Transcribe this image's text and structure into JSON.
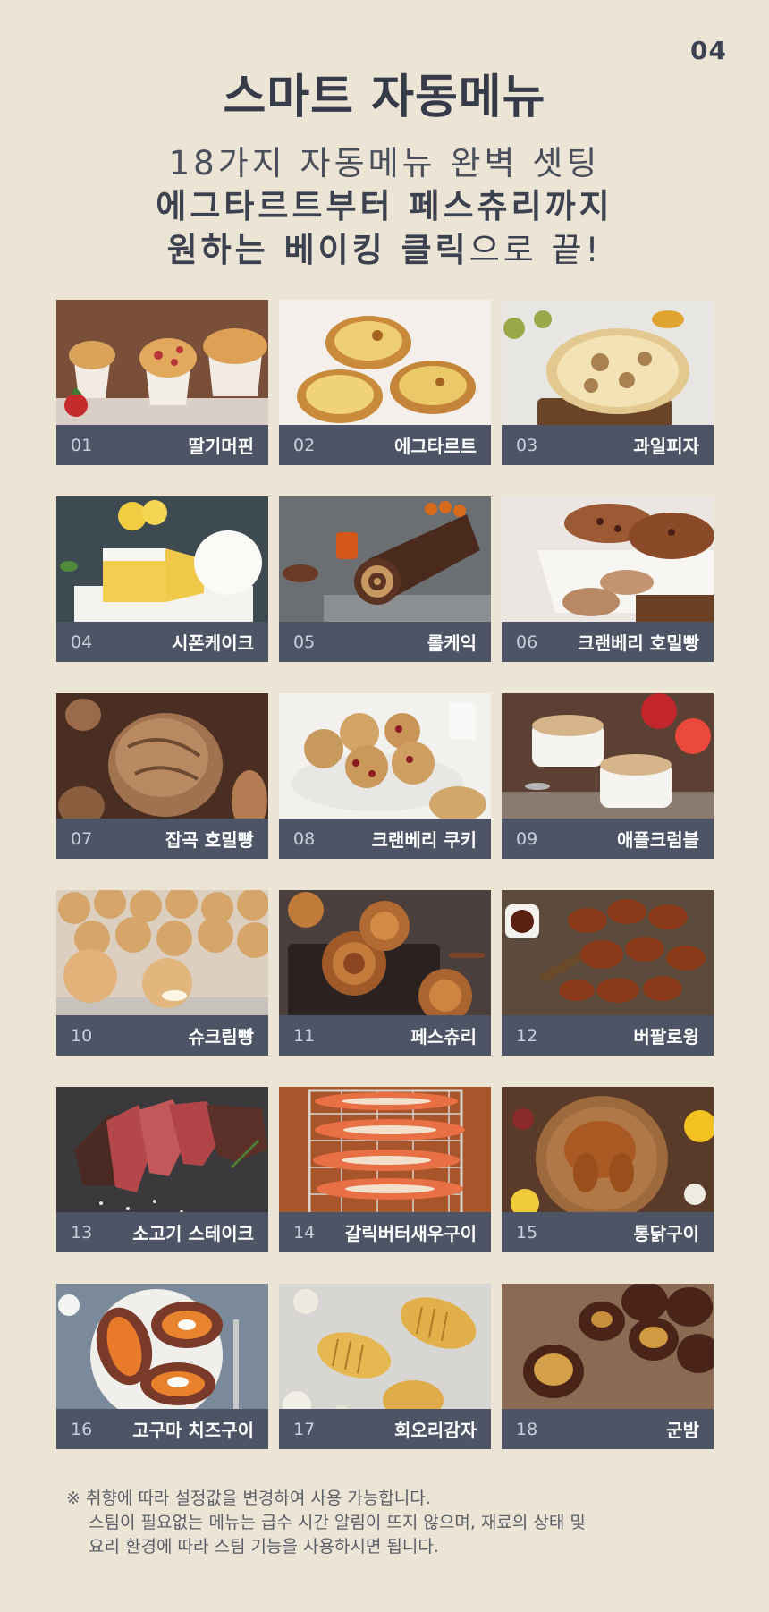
{
  "page_number": "04",
  "title": "스마트 자동메뉴",
  "subtitle_line1": "18가지 자동메뉴 완벽 셋팅",
  "subtitle_line2": "에그타르트부터 페스츄리까지",
  "subtitle_line3_bold": "원하는 베이킹 클릭",
  "subtitle_line3_rest": "으로 끝!",
  "menu_items": [
    {
      "num": "01",
      "name": "딸기머핀"
    },
    {
      "num": "02",
      "name": "에그타르트"
    },
    {
      "num": "03",
      "name": "과일피자"
    },
    {
      "num": "04",
      "name": "시폰케이크"
    },
    {
      "num": "05",
      "name": "롤케익"
    },
    {
      "num": "06",
      "name": "크랜베리 호밀빵"
    },
    {
      "num": "07",
      "name": "잡곡 호밀빵"
    },
    {
      "num": "08",
      "name": "크랜베리 쿠키"
    },
    {
      "num": "09",
      "name": "애플크럼블"
    },
    {
      "num": "10",
      "name": "슈크림빵"
    },
    {
      "num": "11",
      "name": "페스츄리"
    },
    {
      "num": "12",
      "name": "버팔로윙"
    },
    {
      "num": "13",
      "name": "소고기 스테이크"
    },
    {
      "num": "14",
      "name": "갈릭버터새우구이"
    },
    {
      "num": "15",
      "name": "통닭구이"
    },
    {
      "num": "16",
      "name": "고구마 치즈구이"
    },
    {
      "num": "17",
      "name": "회오리감자"
    },
    {
      "num": "18",
      "name": "군밤"
    }
  ],
  "note": {
    "line1": "※ 취향에 따라 설정값을 변경하여 사용 가능합니다.",
    "line2": "스팀이 필요없는 메뉴는 급수 시간 알림이 뜨지 않으며, 재료의 상태 및",
    "line3": "요리 환경에 따라 스팀 기능을 사용하시면 됩니다."
  },
  "colors": {
    "background": "#ece4d4",
    "caption_bar": "#4c5466",
    "title_text": "#363b49"
  }
}
